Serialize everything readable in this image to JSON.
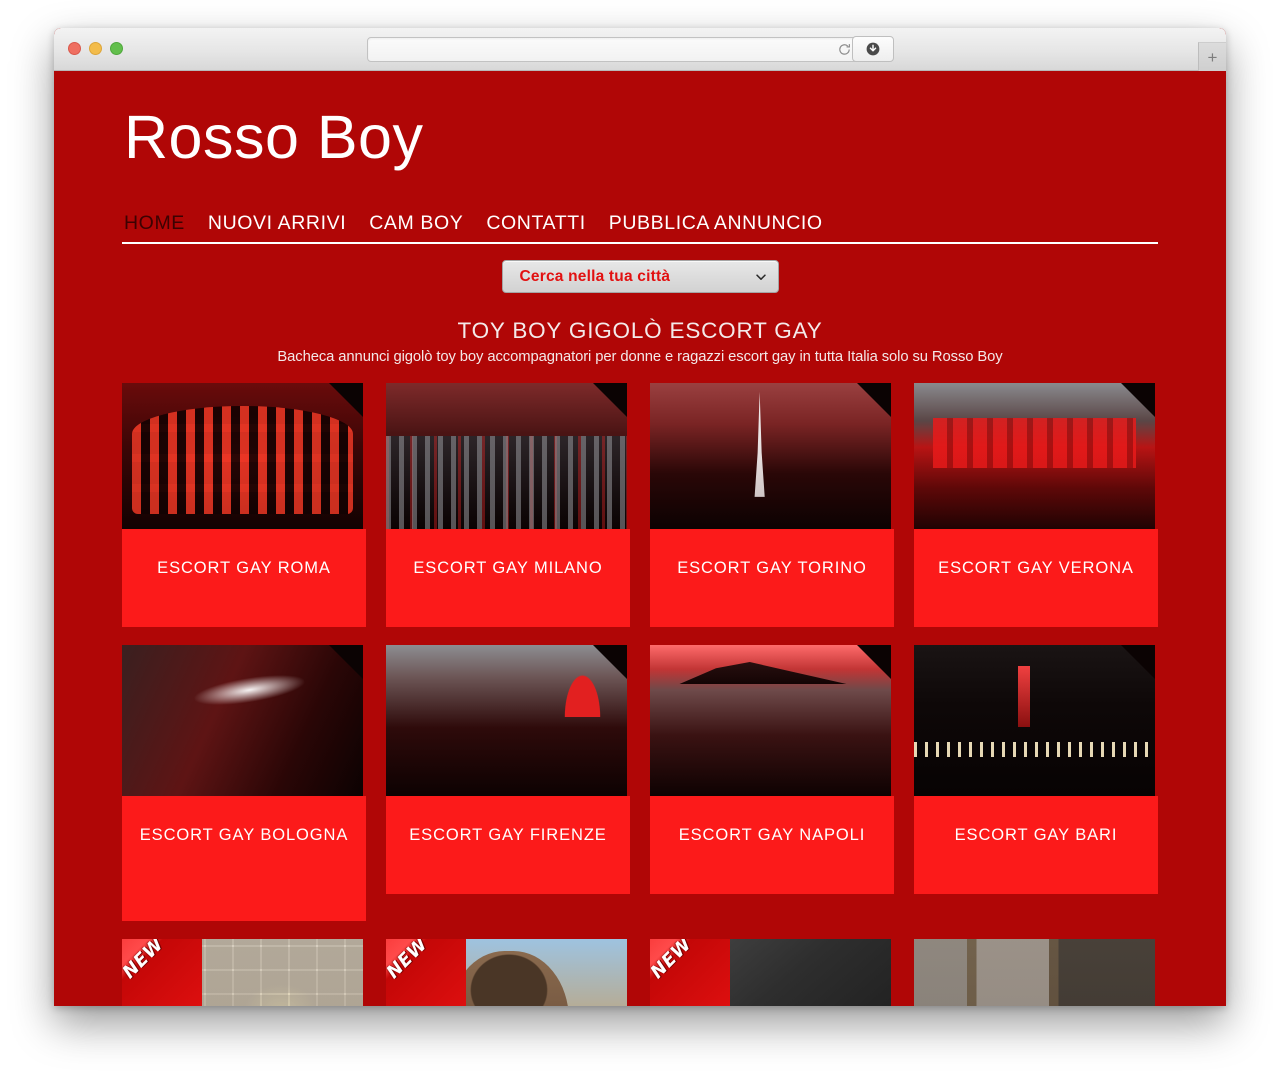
{
  "browser": {
    "url_value": "",
    "url_placeholder": "",
    "reload_icon": "reload-icon",
    "download_icon": "download-icon",
    "newtab_label": "+",
    "traffic_lights": [
      "close",
      "minimize",
      "zoom"
    ]
  },
  "site": {
    "logo": "Rosso Boy",
    "nav": [
      {
        "label": "HOME",
        "active": true
      },
      {
        "label": "NUOVI ARRIVI",
        "active": false
      },
      {
        "label": "CAM BOY",
        "active": false
      },
      {
        "label": "CONTATTI",
        "active": false
      },
      {
        "label": "PUBBLICA ANNUNCIO",
        "active": false
      }
    ],
    "city_select": {
      "selected": "Cerca nella tua città",
      "chevron_icon": "chevron-down-icon"
    },
    "title": "TOY BOY GIGOLÒ ESCORT GAY",
    "subtitle": "Bacheca annunci gigolò toy boy accompagnatori per donne e ragazzi escort gay in tutta Italia solo su Rosso Boy",
    "colors": {
      "page_background": "#b00606",
      "caption_background": "#fc1a1a",
      "accent_text": "#e21111",
      "nav_active": "#3c0202",
      "nav_text": "#ffffff"
    },
    "rows": [
      {
        "cards": [
          {
            "label": "ESCORT GAY ROMA",
            "photo": "ph-roma",
            "badge": "",
            "notch": true,
            "tall": false
          },
          {
            "label": "ESCORT GAY MILANO",
            "photo": "ph-milano",
            "badge": "",
            "notch": true,
            "tall": false
          },
          {
            "label": "ESCORT GAY TORINO",
            "photo": "ph-torino",
            "badge": "",
            "notch": true,
            "tall": false
          },
          {
            "label": "ESCORT GAY VERONA",
            "photo": "ph-verona",
            "badge": "",
            "notch": true,
            "tall": false
          }
        ]
      },
      {
        "cards": [
          {
            "label": "ESCORT GAY BOLOGNA",
            "photo": "ph-bologna",
            "badge": "",
            "notch": true,
            "tall": true
          },
          {
            "label": "ESCORT GAY FIRENZE",
            "photo": "ph-firenze",
            "badge": "",
            "notch": true,
            "tall": false
          },
          {
            "label": "ESCORT GAY NAPOLI",
            "photo": "ph-napoli",
            "badge": "",
            "notch": true,
            "tall": false
          },
          {
            "label": "ESCORT GAY BARI",
            "photo": "ph-bari",
            "badge": "",
            "notch": true,
            "tall": false
          }
        ]
      },
      {
        "cards": [
          {
            "label": "",
            "photo": "ph-bagno",
            "badge": "NEW",
            "notch": false,
            "tall": false
          },
          {
            "label": "",
            "photo": "ph-tattoo",
            "badge": "NEW",
            "notch": false,
            "tall": false
          },
          {
            "label": "",
            "photo": "ph-dark",
            "badge": "NEW",
            "notch": false,
            "tall": false
          },
          {
            "label": "",
            "photo": "ph-kitchen",
            "badge": "",
            "notch": false,
            "tall": false
          }
        ]
      }
    ]
  }
}
